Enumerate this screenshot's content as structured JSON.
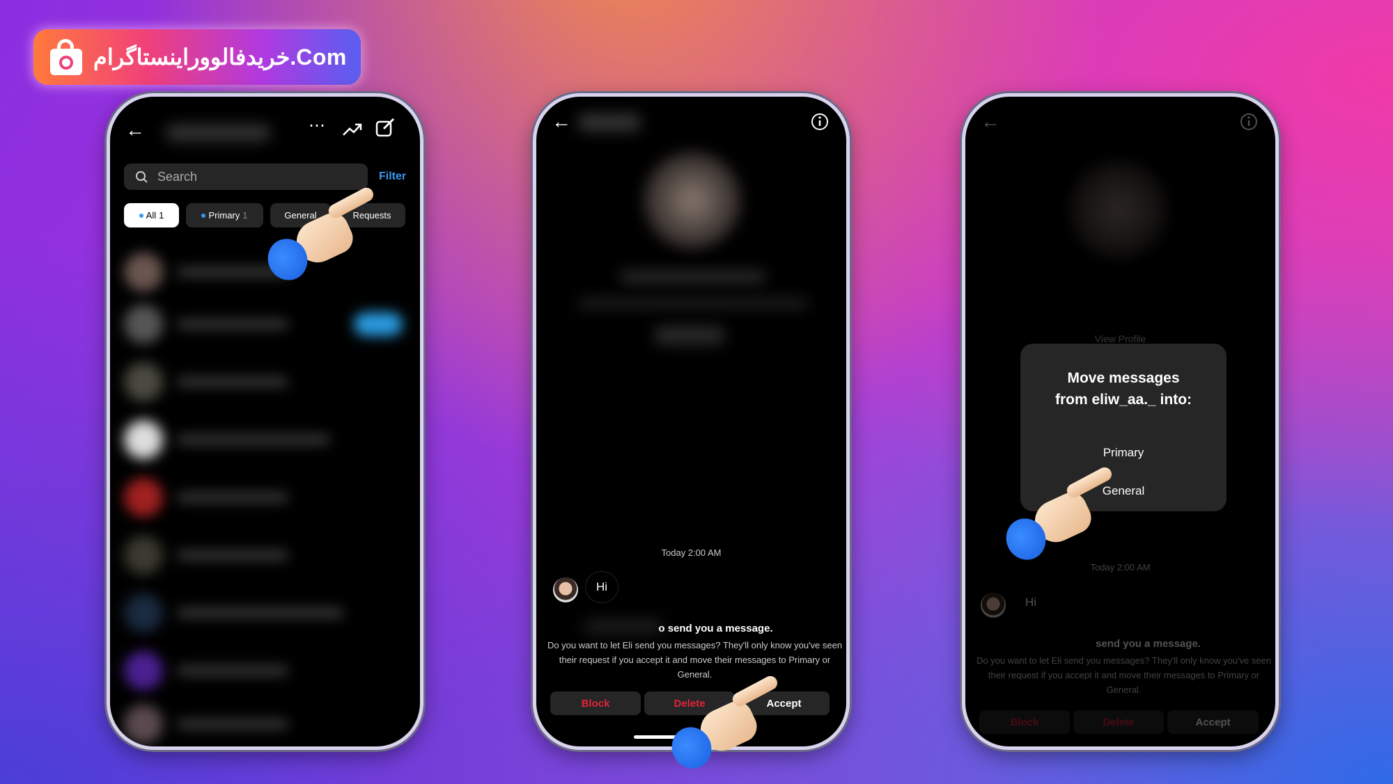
{
  "banner": {
    "brand_text": ".Com",
    "persian_text": "خریدفالووراینستاگرام",
    "icon": "shopping-bag-icon"
  },
  "phone1": {
    "icons": {
      "back": "arrow-left-icon",
      "more": "more-dots-icon",
      "trending": "trending-up-icon",
      "compose": "edit-icon",
      "search": "search-icon"
    },
    "search_placeholder": "Search",
    "filter_label": "Filter",
    "tabs": [
      {
        "label": "All",
        "count": "1",
        "active": true
      },
      {
        "label": "Primary",
        "count": "1",
        "active": false
      },
      {
        "label": "General",
        "count": "",
        "active": false
      },
      {
        "label": "Requests",
        "count": "",
        "active": false
      }
    ]
  },
  "phone2": {
    "icons": {
      "back": "arrow-left-icon",
      "info": "info-icon"
    },
    "timestamp": "Today 2:00 AM",
    "message": "Hi",
    "request_title": "o send you a message.",
    "request_body": "Do you want to let Eli send you messages? They'll only know you've seen their request if you accept it and move their messages to Primary or General.",
    "buttons": {
      "block": "Block",
      "delete": "Delete",
      "accept": "Accept"
    },
    "colors": {
      "danger": "#e0243a"
    }
  },
  "phone3": {
    "view_profile": "View Profile",
    "dialog": {
      "title_line1": "Move messages",
      "title_line2": "from eliw_aa._ into:",
      "option_primary": "Primary",
      "option_general": "General"
    },
    "timestamp": "Today 2:00 AM",
    "message": "Hi",
    "request_title": "send you a message.",
    "request_body": "Do you want to let Eli send you messages? They'll only know you've seen their request if you accept it and move their messages to Primary or General.",
    "buttons": {
      "block": "Block",
      "delete": "Delete",
      "accept": "Accept"
    }
  }
}
